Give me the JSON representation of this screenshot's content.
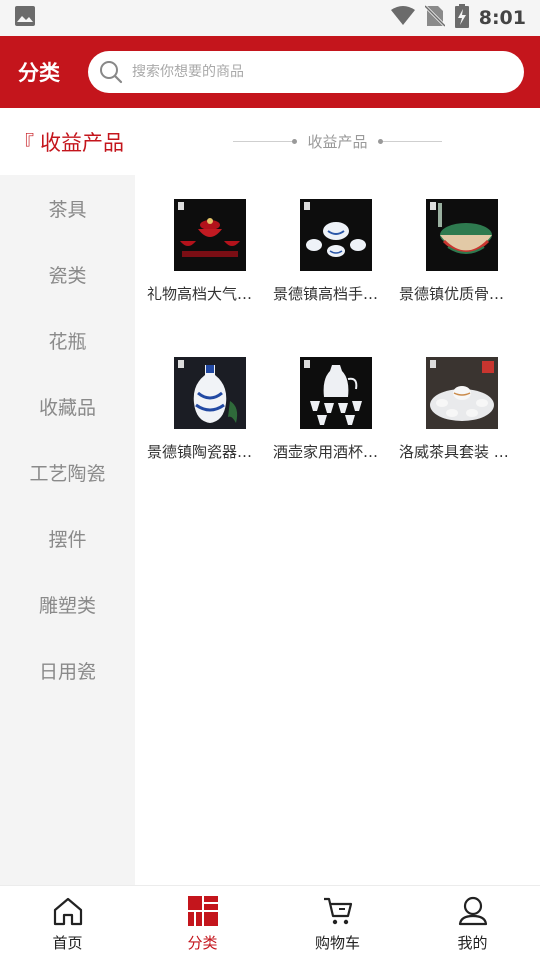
{
  "status_bar": {
    "time": "8:01",
    "icons": [
      "image-icon",
      "wifi-icon",
      "no-sim-icon",
      "battery-icon"
    ]
  },
  "header": {
    "title": "分类",
    "search_placeholder": "搜索你想要的商品"
  },
  "section": {
    "mark": "『",
    "title": "收益产品",
    "sub_header": "收益产品"
  },
  "sidebar": {
    "items": [
      {
        "label": "茶具"
      },
      {
        "label": "瓷类"
      },
      {
        "label": "花瓶"
      },
      {
        "label": "收藏品"
      },
      {
        "label": "工艺陶瓷"
      },
      {
        "label": "摆件"
      },
      {
        "label": "雕塑类"
      },
      {
        "label": "日用瓷"
      }
    ]
  },
  "products": [
    {
      "name": "礼物高档大气…"
    },
    {
      "name": "景德镇高档手…"
    },
    {
      "name": "景德镇优质骨…"
    },
    {
      "name": "景德镇陶瓷器…"
    },
    {
      "name": "酒壶家用酒杯…"
    },
    {
      "name": "洛威茶具套装 …"
    }
  ],
  "bottom_nav": {
    "items": [
      {
        "label": "首页",
        "icon": "home-icon",
        "active": false
      },
      {
        "label": "分类",
        "icon": "category-icon",
        "active": true
      },
      {
        "label": "购物车",
        "icon": "cart-icon",
        "active": false
      },
      {
        "label": "我的",
        "icon": "profile-icon",
        "active": false
      }
    ]
  },
  "colors": {
    "brand": "#c4151c",
    "sidebar_bg": "#f4f4f4",
    "text_muted": "#8a8a8a"
  }
}
